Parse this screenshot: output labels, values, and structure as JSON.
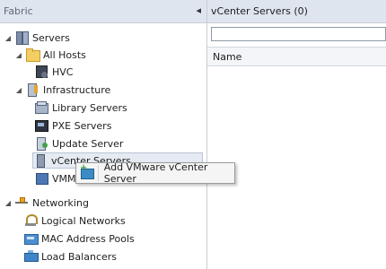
{
  "left_panel": {
    "title": "Fabric",
    "collapse_glyph": "◂"
  },
  "tree": {
    "servers": "Servers",
    "all_hosts": "All Hosts",
    "hvc": "HVC",
    "infrastructure": "Infrastructure",
    "library_servers": "Library Servers",
    "pxe_servers": "PXE Servers",
    "update_server": "Update Server",
    "vcenter_servers": "vCenter Servers",
    "vmm": "VMM",
    "networking": "Networking",
    "logical_networks": "Logical Networks",
    "mac_address_pools": "MAC Address Pools",
    "load_balancers": "Load Balancers"
  },
  "right_panel": {
    "title": "vCenter Servers (0)",
    "filter_value": "",
    "column_name": "Name"
  },
  "context_menu": {
    "add_vcenter": "Add VMware vCenter Server"
  },
  "glyphs": {
    "expanded": "◢",
    "collapsed": "▷"
  }
}
